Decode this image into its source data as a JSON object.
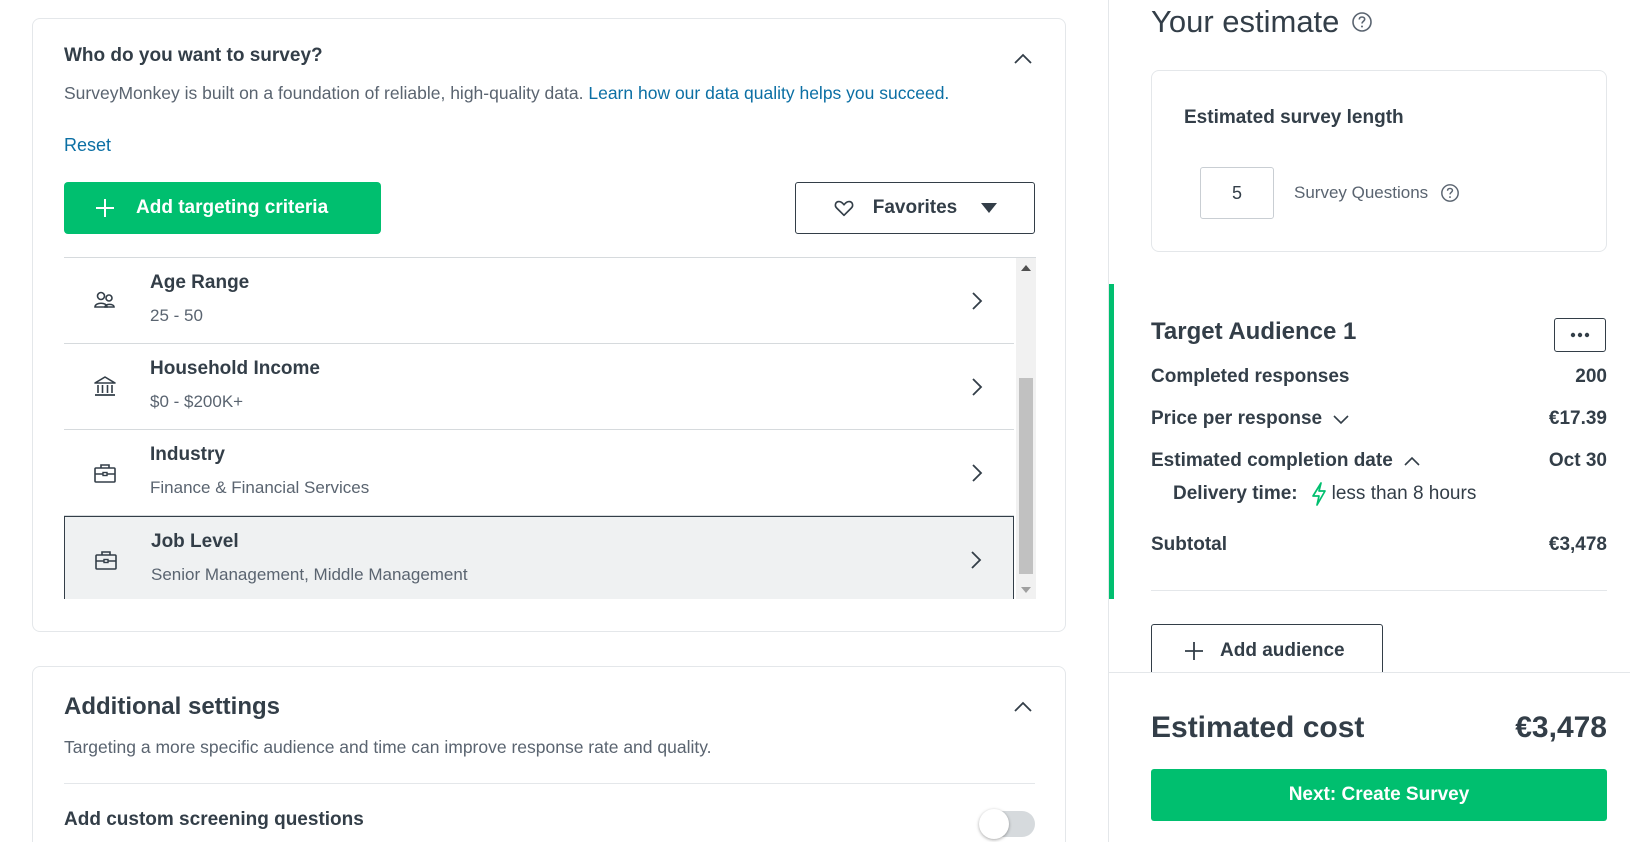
{
  "who": {
    "title": "Who do you want to survey?",
    "description": "SurveyMonkey is built on a foundation of reliable, high-quality data.",
    "learn_link": "Learn how our data quality helps you succeed.",
    "reset_label": "Reset",
    "add_criteria_label": "Add targeting criteria",
    "favorites_label": "Favorites",
    "criteria": [
      {
        "name": "Age Range",
        "value": "25 - 50",
        "icon": "people-icon"
      },
      {
        "name": "Household Income",
        "value": "$0 - $200K+",
        "icon": "bank-icon"
      },
      {
        "name": "Industry",
        "value": "Finance & Financial Services",
        "icon": "briefcase-icon"
      },
      {
        "name": "Job Level",
        "value": "Senior Management, Middle Management",
        "icon": "briefcase-icon"
      }
    ]
  },
  "additional": {
    "title": "Additional settings",
    "description": "Targeting a more specific audience and time can improve response rate and quality.",
    "screening_label": "Add custom screening questions"
  },
  "estimate": {
    "title": "Your estimate",
    "length_title": "Estimated survey length",
    "questions_value": "5",
    "questions_label": "Survey Questions"
  },
  "audience": {
    "title": "Target Audience 1",
    "completed_label": "Completed responses",
    "completed_value": "200",
    "price_label": "Price per response",
    "price_value": "€17.39",
    "date_label": "Estimated completion date",
    "date_value": "Oct 30",
    "delivery_label": "Delivery time:",
    "delivery_value": "less than 8 hours",
    "subtotal_label": "Subtotal",
    "subtotal_value": "€3,478",
    "add_audience_label": "Add audience"
  },
  "footer": {
    "cost_label": "Estimated cost",
    "cost_value": "€3,478",
    "next_label": "Next: Create Survey"
  },
  "colors": {
    "brand_green": "#00bf6f",
    "link_blue": "#0b6fa4",
    "text_dark": "#333e48"
  }
}
